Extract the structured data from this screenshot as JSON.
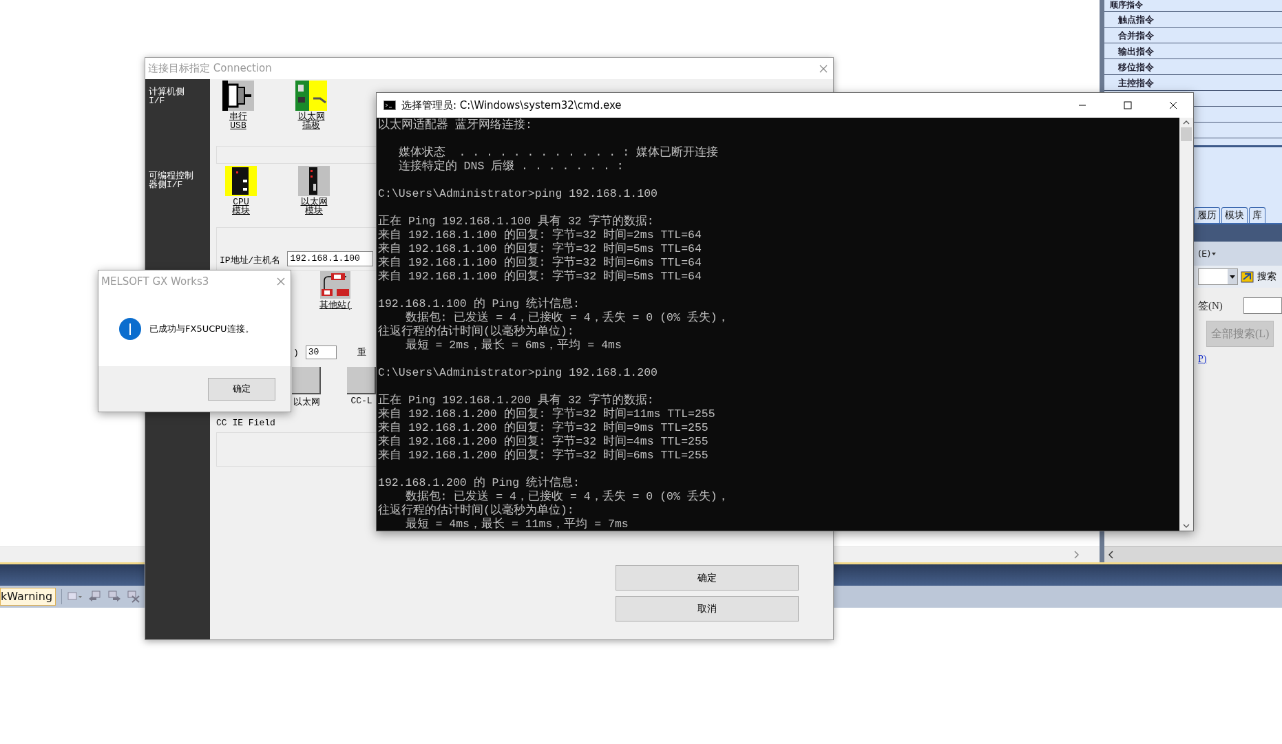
{
  "background_app": {
    "instruction_panel": {
      "header": "顺序指令",
      "items": [
        "触点指令",
        "合并指令",
        "输出指令",
        "移位指令",
        "主控指令"
      ],
      "tabs": [
        {
          "label": "履历",
          "selected": false
        },
        {
          "label": "模块",
          "selected": false
        },
        {
          "label": "库",
          "selected": false
        }
      ]
    },
    "search_panel": {
      "menu_label": "(E)",
      "search_button": "搜索",
      "field_label": "签(N)",
      "search_all_button": "全部搜索(L)",
      "link": "P)"
    },
    "status_toolbar": {
      "filter_value": "kWarning"
    }
  },
  "connection_dialog": {
    "title": "连接目标指定 Connection",
    "computer_side": {
      "label": "计算机侧 I/F",
      "options": [
        {
          "label_lines": [
            "串行",
            "USB"
          ],
          "kind": "serial",
          "selected": false
        },
        {
          "label_lines": [
            "以太网",
            "插板"
          ],
          "kind": "ethernet_board",
          "selected": true
        }
      ]
    },
    "plc_side": {
      "label": "可编程控制器侧I/F",
      "options": [
        {
          "label_lines": [
            "CPU",
            "模块"
          ],
          "kind": "cpu",
          "selected": true
        },
        {
          "label_lines": [
            "以太网",
            "模块"
          ],
          "kind": "ethernet_module",
          "selected": false
        }
      ]
    },
    "ip_label": "IP地址/主机名",
    "ip_value": "192.168.1.100",
    "other_station": "其他站(",
    "timeout_label": ")",
    "timeout_value": "30",
    "retry_label": "重",
    "networks": [
      {
        "label": "以太网"
      },
      {
        "label": "CC-L"
      }
    ],
    "network_group": "CC IE Field",
    "buttons": [
      "确定",
      "取消"
    ]
  },
  "cmd_window": {
    "title": "选择管理员: C:\\Windows\\system32\\cmd.exe",
    "blocks": [
      [
        "以太网适配器 蓝牙网络连接:"
      ],
      [
        "   媒体状态  . . . . . . . . . . . . : 媒体已断开连接",
        "   连接特定的 DNS 后缀 . . . . . . . :"
      ],
      [
        "C:\\Users\\Administrator>ping 192.168.1.100"
      ],
      [
        "正在 Ping 192.168.1.100 具有 32 字节的数据:",
        "来自 192.168.1.100 的回复: 字节=32 时间=2ms TTL=64",
        "来自 192.168.1.100 的回复: 字节=32 时间=5ms TTL=64",
        "来自 192.168.1.100 的回复: 字节=32 时间=6ms TTL=64",
        "来自 192.168.1.100 的回复: 字节=32 时间=5ms TTL=64"
      ],
      [
        "192.168.1.100 的 Ping 统计信息:",
        "    数据包: 已发送 = 4，已接收 = 4，丢失 = 0 (0% 丢失)，",
        "往返行程的估计时间(以毫秒为单位):",
        "    最短 = 2ms，最长 = 6ms，平均 = 4ms"
      ],
      [
        "C:\\Users\\Administrator>ping 192.168.1.200"
      ],
      [
        "正在 Ping 192.168.1.200 具有 32 字节的数据:",
        "来自 192.168.1.200 的回复: 字节=32 时间=11ms TTL=255",
        "来自 192.168.1.200 的回复: 字节=32 时间=9ms TTL=255",
        "来自 192.168.1.200 的回复: 字节=32 时间=4ms TTL=255",
        "来自 192.168.1.200 的回复: 字节=32 时间=6ms TTL=255"
      ],
      [
        "192.168.1.200 的 Ping 统计信息:",
        "    数据包: 已发送 = 4，已接收 = 4，丢失 = 0 (0% 丢失)，",
        "往返行程的估计时间(以毫秒为单位):",
        "    最短 = 4ms，最长 = 11ms，平均 = 7ms"
      ]
    ]
  },
  "message_box": {
    "title": "MELSOFT GX Works3",
    "message": "已成功与FX5UCPU连接。",
    "button": "确定"
  }
}
